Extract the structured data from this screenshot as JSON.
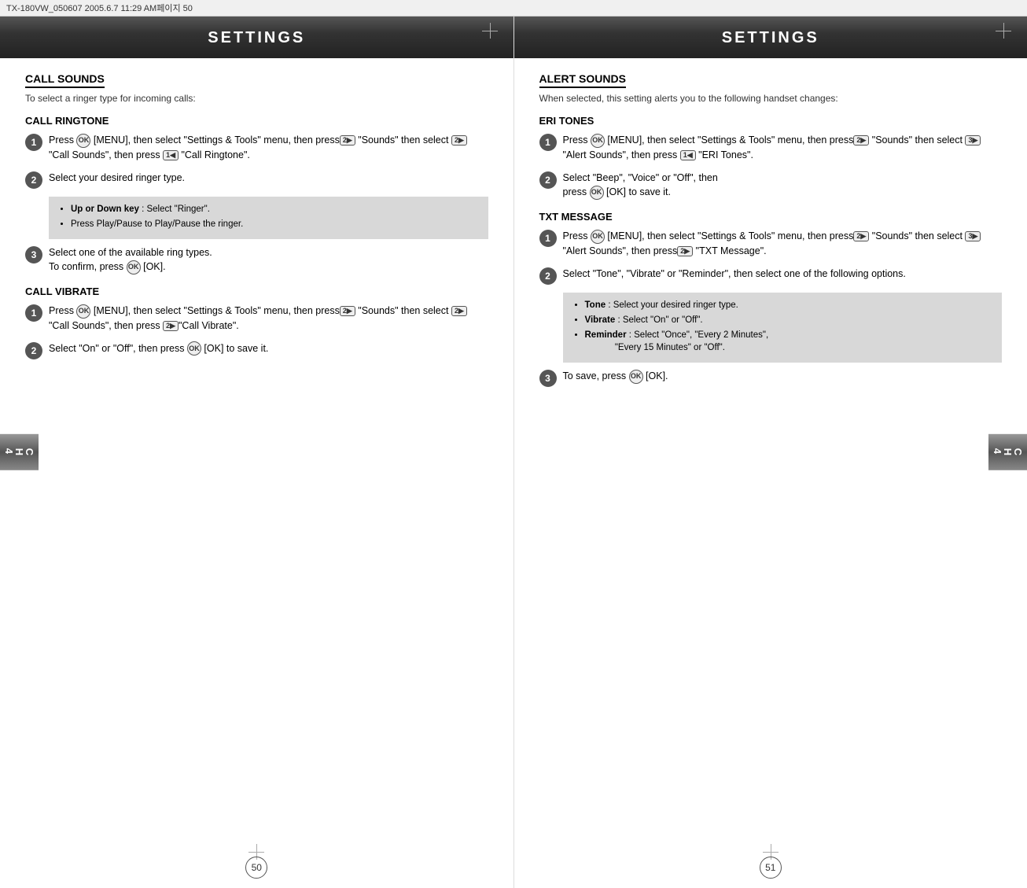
{
  "file_bar": {
    "text": "TX-180VW_050607  2005.6.7 11:29 AM페이지 50"
  },
  "left_page": {
    "header": "SETTINGS",
    "section_title": "CALL SOUNDS",
    "section_desc": "To select a ringer type for incoming calls:",
    "subsections": [
      {
        "title": "CALL RINGTONE",
        "steps": [
          {
            "num": "1",
            "html": "Press <ok> [MENU], then select \"Settings & Tools\" menu, then press<2m> \"Sounds\" then select <2m> \"Call Sounds\", then press <1c> \"Call Ringtone\"."
          },
          {
            "num": "2",
            "text": "Select your desired ringer type."
          }
        ],
        "info_box": [
          {
            "bold": "Up or Down key",
            "text": " : Select \"Ringer\"."
          },
          {
            "bold": "",
            "text": "Press Play/Pause to Play/Pause the ringer."
          }
        ],
        "steps2": [
          {
            "num": "3",
            "text": "Select one of the available ring types. To confirm, press [OK]."
          }
        ]
      },
      {
        "title": "CALL VIBRATE",
        "steps": [
          {
            "num": "1",
            "text": "Press [MENU], then select \"Settings & Tools\" menu, then press \"Sounds\" then select \"Call Sounds\", then press \"Call Vibrate\"."
          },
          {
            "num": "2",
            "text": "Select \"On\" or \"Off\", then press [OK] to save it."
          }
        ]
      }
    ],
    "page_number": "50",
    "ch_tab": "CH\n4"
  },
  "right_page": {
    "header": "SETTINGS",
    "section_title": "ALERT SOUNDS",
    "section_desc": "When selected, this setting alerts you to the following handset changes:",
    "subsections": [
      {
        "title": "ERI TONES",
        "steps": [
          {
            "num": "1",
            "text": "Press [MENU], then select \"Settings & Tools\" menu, then press \"Sounds\" then select \"Alert Sounds\", then press \"ERI Tones\"."
          },
          {
            "num": "2",
            "text": "Select \"Beep\", \"Voice\" or \"Off\", then press [OK] to save it."
          }
        ]
      },
      {
        "title": "TXT MESSAGE",
        "steps": [
          {
            "num": "1",
            "text": "Press [MENU], then select \"Settings & Tools\" menu, then press \"Sounds\" then select \"Alert Sounds\", then press \"TXT Message\"."
          },
          {
            "num": "2",
            "text": "Select \"Tone\", \"Vibrate\" or \"Reminder\", then select one of the following options."
          }
        ],
        "info_box": [
          {
            "bold": "Tone",
            "text": " : Select your desired ringer type."
          },
          {
            "bold": "Vibrate",
            "text": " : Select \"On\" or \"Off\"."
          },
          {
            "bold": "Reminder",
            "text": " : Select \"Once\", \"Every 2 Minutes\", \"Every 15 Minutes\" or \"Off\"."
          }
        ],
        "steps2": [
          {
            "num": "3",
            "text": "To save, press [OK]."
          }
        ]
      }
    ],
    "page_number": "51",
    "ch_tab": "CH\n4"
  }
}
